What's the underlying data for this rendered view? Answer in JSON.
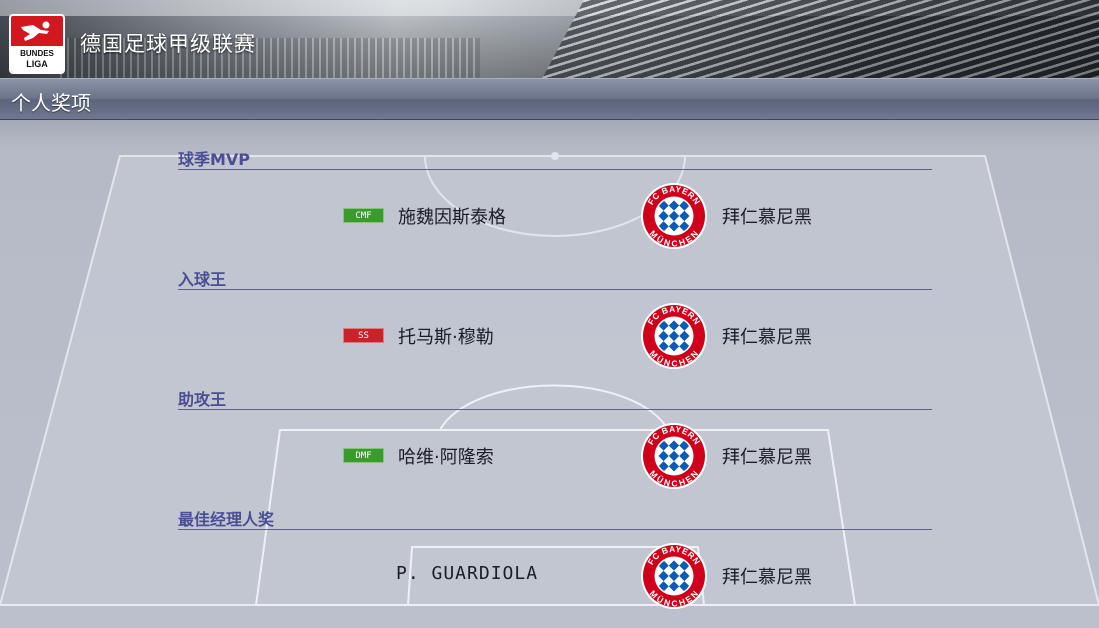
{
  "header": {
    "league_logo": {
      "line1": "BUNDES",
      "line2": "LIGA",
      "icon": "bundesliga-logo-icon"
    },
    "league_title": "德国足球甲级联赛"
  },
  "section": {
    "title": "个人奖项"
  },
  "awards": [
    {
      "title": "球季MVP",
      "position": "CMF",
      "position_color": "#3a9a2c",
      "player": "施魏因斯泰格",
      "club": "拜仁慕尼黑",
      "club_logo": "fc-bayern-crest-icon"
    },
    {
      "title": "入球王",
      "position": "SS",
      "position_color": "#c8232a",
      "player": "托马斯·穆勒",
      "club": "拜仁慕尼黑",
      "club_logo": "fc-bayern-crest-icon"
    },
    {
      "title": "助攻王",
      "position": "DMF",
      "position_color": "#3a9a2c",
      "player": "哈维·阿隆索",
      "club": "拜仁慕尼黑",
      "club_logo": "fc-bayern-crest-icon"
    },
    {
      "title": "最佳经理人奖",
      "position": "",
      "position_color": "",
      "player": "P. GUARDIOLA",
      "club": "拜仁慕尼黑",
      "club_logo": "fc-bayern-crest-icon"
    }
  ],
  "crest": {
    "top_text": "FC BAYERN",
    "bottom_text": "MÜNCHEN",
    "ring_color": "#d0021b",
    "diamond_blue": "#0a5bb5"
  }
}
